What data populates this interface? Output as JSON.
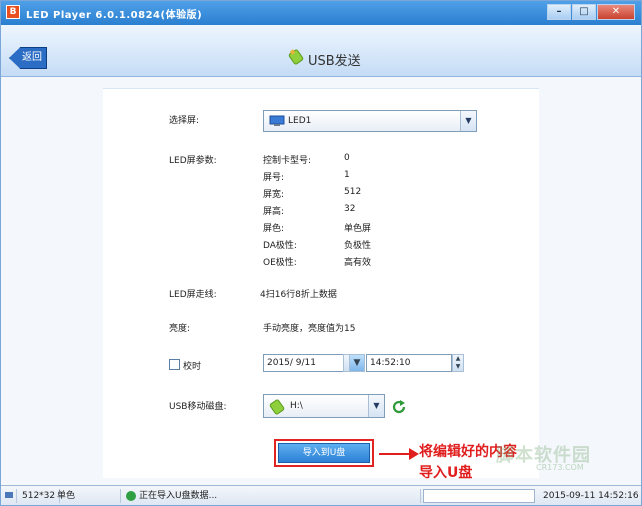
{
  "window": {
    "title": "LED Player 6.0.1.0824(体验版)",
    "app_icon": "B",
    "btn_min": "–",
    "btn_max": "□",
    "btn_close": "✕"
  },
  "header": {
    "back_label": "返回",
    "page_title": "USB发送"
  },
  "form": {
    "screen_label": "选择屏:",
    "screen_value": "LED1",
    "params_label": "LED屏参数:",
    "params": [
      {
        "key": "控制卡型号:",
        "value": "0"
      },
      {
        "key": "屏号:",
        "value": "1"
      },
      {
        "key": "屏宽:",
        "value": "512"
      },
      {
        "key": "屏高:",
        "value": "32"
      },
      {
        "key": "屏色:",
        "value": "单色屏"
      },
      {
        "key": "DA极性:",
        "value": "负极性"
      },
      {
        "key": "OE极性:",
        "value": "高有效"
      }
    ],
    "scan_label": "LED屏走线:",
    "scan_value": "4扫16行8折上数据",
    "brightness_label": "亮度:",
    "brightness_value": "手动亮度，亮度值为15",
    "timing_label": "校时",
    "date_value": "2015/ 9/11",
    "time_value": "14:52:10",
    "usb_label": "USB移动磁盘:",
    "usb_value": "H:\\",
    "import_button": "导入到U盘"
  },
  "annotation": {
    "line1": "将编辑好的内容",
    "line2": "导入U盘"
  },
  "watermark": {
    "main": "脚本软件园",
    "sub": "CR173.COM"
  },
  "statusbar": {
    "size": "512*32",
    "color": "单色",
    "status": "正在导入U盘数据...",
    "progress": 0,
    "datetime": "2015-09-11  14:52:16"
  }
}
